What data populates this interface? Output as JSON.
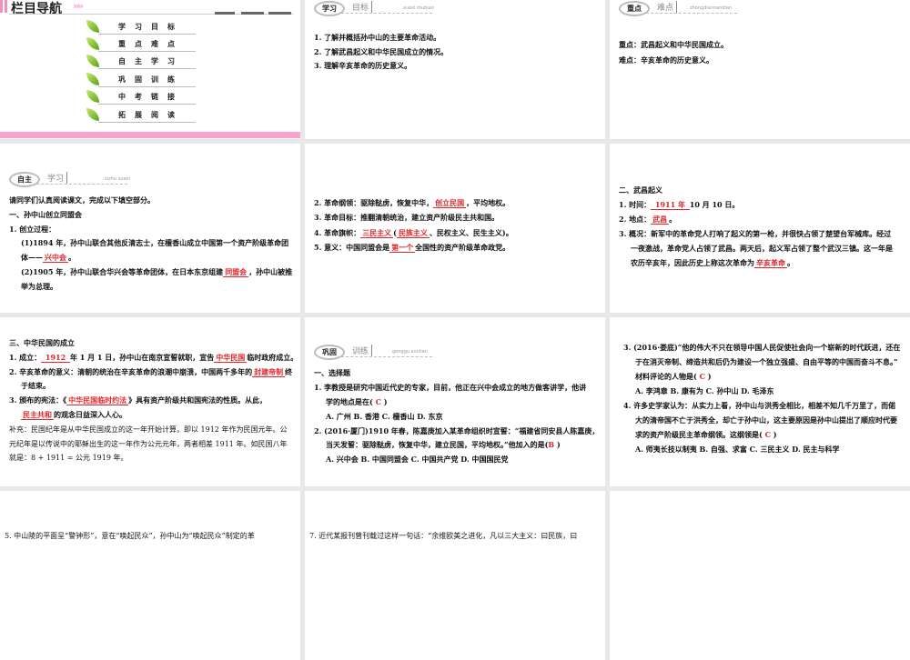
{
  "nav": {
    "title": "栏目导航",
    "chevrons": "»»",
    "items": [
      "学习目标",
      "重点难点",
      "自主学习",
      "巩固训练",
      "中考链接",
      "拓展阅读"
    ]
  },
  "badges": {
    "goals": {
      "main": "学习",
      "sub": "目标",
      "pinyin": "xuexi mubiao"
    },
    "key": {
      "main": "重点",
      "sub": "难点",
      "pinyin": "zhongdiannandian"
    },
    "self": {
      "main": "自主",
      "sub": "学习",
      "pinyin": "zizhu xuexi"
    },
    "practice": {
      "main": "巩固",
      "sub": "训练",
      "pinyin": "gonggu xunlian"
    }
  },
  "slides": {
    "goals": [
      {
        "segs": [
          {
            "t": "1. 了解并概括孙中山的主要革命活动。"
          }
        ]
      },
      {
        "segs": [
          {
            "t": "2. 了解武昌起义和中华民国成立的情况。"
          }
        ]
      },
      {
        "segs": [
          {
            "t": "3. 理解辛亥革命的历史意义。"
          }
        ]
      }
    ],
    "key": [
      {
        "segs": [
          {
            "t": "重点：武昌起义和中华民国成立。"
          }
        ]
      },
      {
        "segs": [
          {
            "t": "难点：辛亥革命的历史意义。"
          }
        ]
      }
    ],
    "self1": [
      {
        "segs": [
          {
            "t": "请同学们认真阅读课文，完成以下填空部分。"
          }
        ]
      },
      {
        "segs": [
          {
            "t": "一、孙中山创立同盟会"
          }
        ]
      },
      {
        "segs": [
          {
            "t": "1. 创立过程："
          }
        ]
      },
      {
        "ind": true,
        "segs": [
          {
            "t": "(1)1894 年，孙中山联合其他反清志士，在檀香山成立中国第一个资产阶级革命团"
          }
        ]
      },
      {
        "ind": true,
        "segs": [
          {
            "t": "体——"
          },
          {
            "t": "兴中会",
            "fill": true
          },
          {
            "t": "。"
          }
        ]
      },
      {
        "ind": true,
        "segs": [
          {
            "t": "(2)1905 年，孙中山联合华兴会等革命团体，在日本东京组建"
          },
          {
            "t": "同盟会",
            "fill": true
          },
          {
            "t": "，孙中山被推"
          }
        ]
      },
      {
        "ind": true,
        "segs": [
          {
            "t": "举为总理。"
          }
        ]
      }
    ],
    "self2": [
      {
        "segs": [
          {
            "t": "2. 革命纲领：驱除鞑虏，恢复中华，"
          },
          {
            "t": "创立民国",
            "fill": true
          },
          {
            "t": "，平均地权。"
          }
        ]
      },
      {
        "segs": [
          {
            "t": "3. 革命目标：推翻清朝统治，建立资产阶级民主共和国。"
          }
        ]
      },
      {
        "segs": [
          {
            "t": "4. 革命旗帜："
          },
          {
            "t": "三民主义",
            "fill": true
          },
          {
            "t": "("
          },
          {
            "t": "民族主义",
            "fill": true
          },
          {
            "t": "、民权主义、民生主义)。"
          }
        ]
      },
      {
        "segs": [
          {
            "t": "5. 意义：中国同盟会是"
          },
          {
            "t": "第一个",
            "fill": true
          },
          {
            "t": "全国性的资产阶级革命政党。"
          }
        ]
      }
    ],
    "self3": [
      {
        "segs": [
          {
            "t": "二、武昌起义"
          }
        ]
      },
      {
        "segs": [
          {
            "t": "1. 时间："
          },
          {
            "t": "  1911 年  ",
            "fill": true
          },
          {
            "t": "10 月 10 日。"
          }
        ]
      },
      {
        "segs": [
          {
            "t": "2. 地点："
          },
          {
            "t": "武昌",
            "fill": true
          },
          {
            "t": "。"
          }
        ]
      },
      {
        "segs": [
          {
            "t": "3. 概况：新军中的革命党人打响了起义的第一枪，并很快占领了楚望台军械库。经过"
          }
        ]
      },
      {
        "ind": true,
        "segs": [
          {
            "t": "一夜激战，革命党人占领了武昌。两天后，起义军占领了整个武汉三镇。这一年是"
          }
        ]
      },
      {
        "ind": true,
        "segs": [
          {
            "t": "农历辛亥年，因此历史上称这次革命为"
          },
          {
            "t": "辛亥革命",
            "fill": true
          },
          {
            "t": "。"
          }
        ]
      }
    ],
    "self4": [
      {
        "segs": [
          {
            "t": "三、中华民国的成立"
          }
        ]
      },
      {
        "segs": [
          {
            "t": "1. 成立："
          },
          {
            "t": "   1912   ",
            "fill": true
          },
          {
            "t": "年 1 月 1 日，孙中山在南京宣誓就职，宣告"
          },
          {
            "t": "中华民国",
            "fill": true
          },
          {
            "t": "临时政府成立。"
          }
        ]
      },
      {
        "segs": [
          {
            "t": "2. 辛亥革命的意义：清朝的统治在辛亥革命的浪潮中崩溃，中国两千多年的"
          },
          {
            "t": "封建帝制",
            "fill": true
          },
          {
            "t": "终"
          }
        ]
      },
      {
        "ind": true,
        "segs": [
          {
            "t": "于结束。"
          }
        ]
      },
      {
        "segs": [
          {
            "t": "3. 颁布的宪法：《"
          },
          {
            "t": "中华民国临时约法",
            "fill": true
          },
          {
            "t": "》具有资产阶级共和国宪法的性质。从此，"
          }
        ]
      },
      {
        "ind": true,
        "segs": [
          {
            "t": "民主共和",
            "fill": true
          },
          {
            "t": "的观念日益深入人心。"
          }
        ]
      },
      {
        "supp": true,
        "segs": [
          {
            "t": "补充：民国纪年是从中华民国成立的这一年开始计算，即以 1912 年作为民国元年。公"
          }
        ]
      },
      {
        "supp": true,
        "segs": [
          {
            "t": "元纪年是以传说中的耶稣出生的这一年作为公元元年，两者相差 1911 年。如民国八年"
          }
        ]
      },
      {
        "supp": true,
        "segs": [
          {
            "t": "就是：8 + 1911 = 公元 1919 年。"
          }
        ]
      }
    ],
    "practice1": [
      {
        "segs": [
          {
            "t": "一、选择题"
          }
        ]
      },
      {
        "segs": [
          {
            "t": "1. 李教授是研究中国近代史的专家，目前，他正在兴中会成立的地方做客讲学，他讲"
          }
        ]
      },
      {
        "ind": true,
        "segs": [
          {
            "t": "学的地点是在(  "
          },
          {
            "t": "C",
            "ans": true
          },
          {
            "t": " )"
          }
        ]
      },
      {
        "ind": true,
        "segs": [
          {
            "t": "A. 广州              B. 香港              C. 檀香山          D. 东京"
          }
        ]
      },
      {
        "segs": [
          {
            "t": "2. (2016·厦门)1910 年春，陈嘉庚加入某革命组织时宣誓：“福建省同安县人陈嘉庚，"
          }
        ]
      },
      {
        "ind": true,
        "segs": [
          {
            "t": "当天发誓：驱除鞑虏，恢复中华，建立民国，平均地权。”他加入的是("
          },
          {
            "t": "B",
            "ans": true
          },
          {
            "t": "  )"
          }
        ]
      },
      {
        "ind": true,
        "segs": [
          {
            "t": "A. 兴中会       B. 中国同盟会       C. 中国共产党         D. 中国国民党"
          }
        ]
      }
    ],
    "practice2": [
      {
        "segs": [
          {
            "t": "3. (2016·娄底)“他的伟大不只在领导中国人民促使社会向一个崭新的时代跃进，还在"
          }
        ]
      },
      {
        "ind": true,
        "segs": [
          {
            "t": "于在消灭帝制、缔造共和后仍为建设一个独立强盛、自由平等的中国而奋斗不息。”"
          }
        ]
      },
      {
        "ind": true,
        "segs": [
          {
            "t": "材料评论的人物是(  "
          },
          {
            "t": "C",
            "ans": true
          },
          {
            "t": " )"
          }
        ]
      },
      {
        "ind": true,
        "segs": [
          {
            "t": "A. 李鸿章          B. 康有为          C. 孙中山       D. 毛泽东"
          }
        ]
      },
      {
        "segs": [
          {
            "t": "4. 许多史学家认为：从实力上看，孙中山与洪秀全相比，相差不知几千万里了，而偌"
          }
        ]
      },
      {
        "ind": true,
        "segs": [
          {
            "t": "大的清帝国不亡于洪秀全，却亡于孙中山，这主要原因是孙中山提出了顺应时代要"
          }
        ]
      },
      {
        "ind": true,
        "segs": [
          {
            "t": "求的资产阶级民主革命纲领。这纲领是(  "
          },
          {
            "t": "C",
            "ans": true
          },
          {
            "t": "  )"
          }
        ]
      },
      {
        "ind": true,
        "segs": [
          {
            "t": "A. 师夷长技以制夷       B. 自强、求富       C. 三民主义         D. 民主与科学"
          }
        ]
      }
    ],
    "practice3": [
      {
        "segs": [
          {
            "t": "5. 中山陵的平面呈“警钟形”，意在“唤起民众”，孙中山为“唤起民众”制定的革"
          }
        ]
      }
    ],
    "practice4": [
      {
        "segs": [
          {
            "t": "7. 近代某报刊曾刊载过这样一句话：“余维欧美之进化，凡以三大主义：曰民族，曰"
          }
        ]
      }
    ]
  }
}
